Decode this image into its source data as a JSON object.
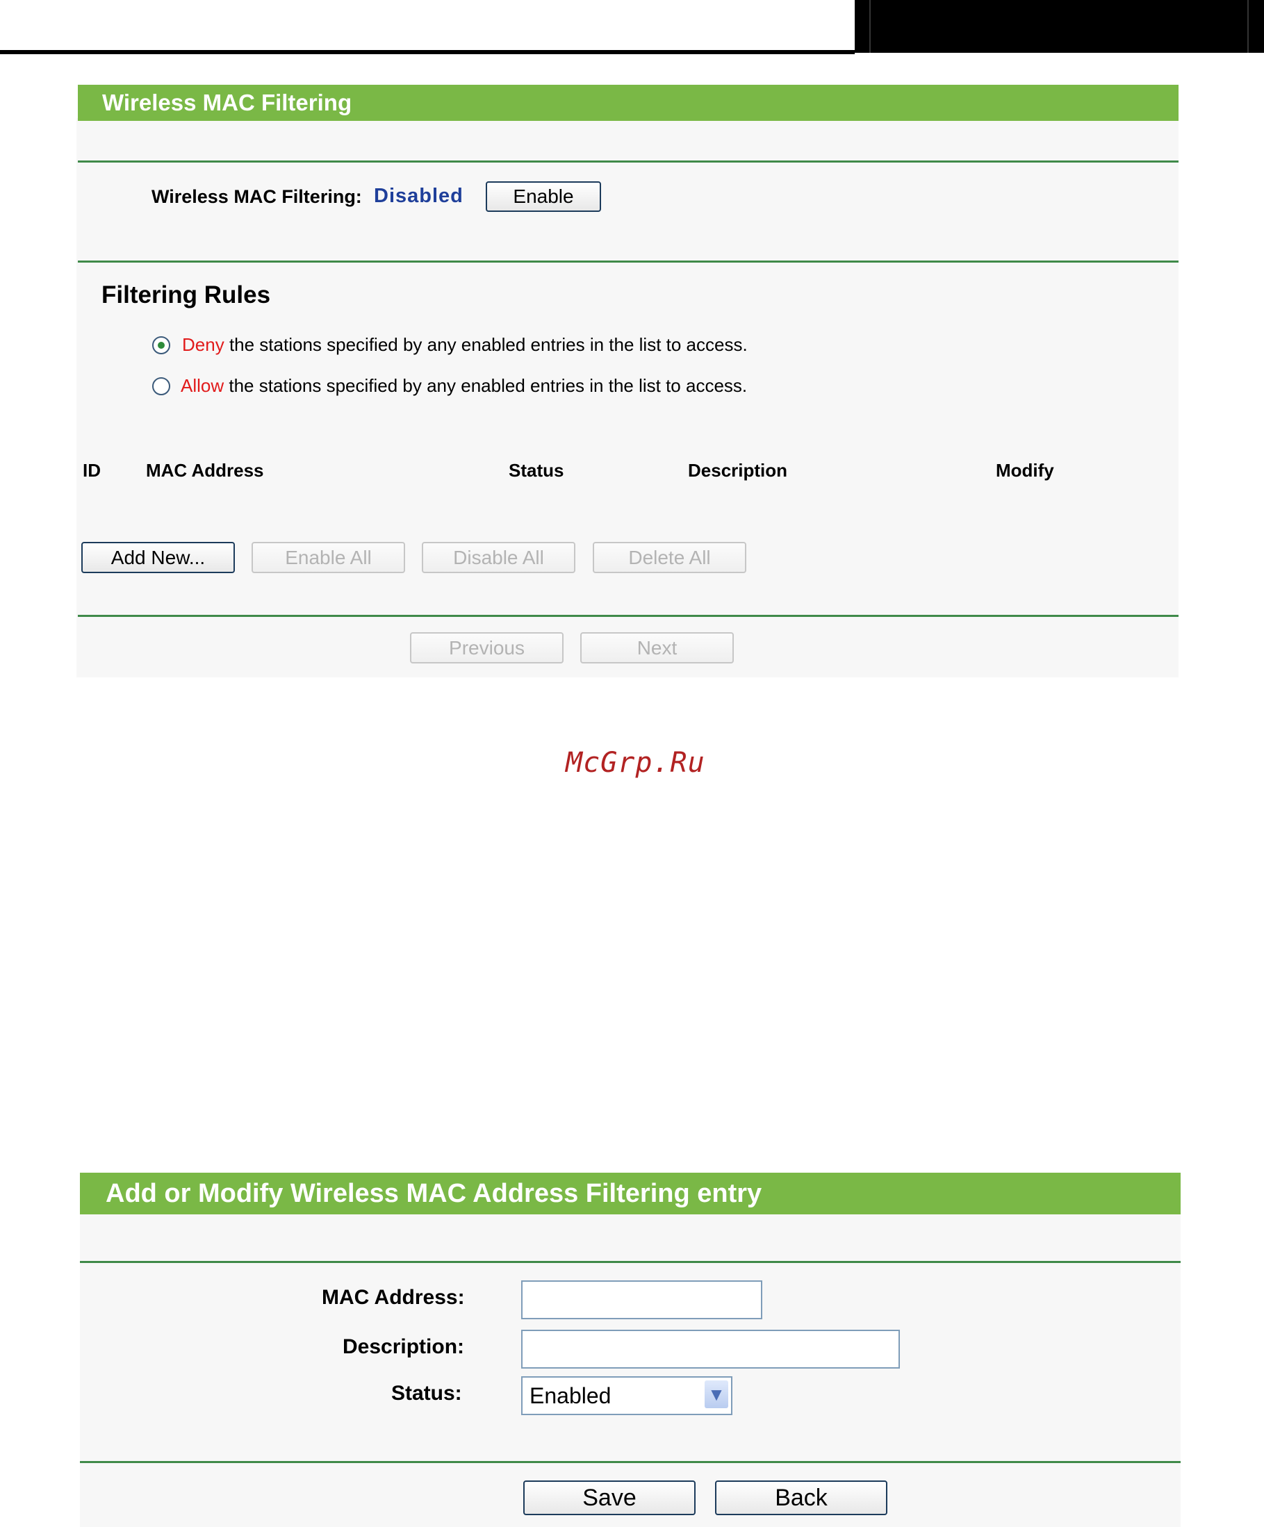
{
  "panel1": {
    "title": "Wireless MAC Filtering",
    "filtering_label": "Wireless MAC Filtering:",
    "filtering_status": "Disabled",
    "enable_button": "Enable",
    "rules_heading": "Filtering Rules",
    "deny_word": "Deny",
    "deny_text": "the stations specified by any enabled entries in the list to access.",
    "allow_word": "Allow",
    "allow_text": "the stations specified by any enabled entries in the list to access.",
    "columns": [
      "ID",
      "MAC Address",
      "Status",
      "Description",
      "Modify"
    ],
    "buttons": {
      "add_new": "Add New...",
      "enable_all": "Enable All",
      "disable_all": "Disable All",
      "delete_all": "Delete All",
      "previous": "Previous",
      "next": "Next"
    }
  },
  "watermark": "McGrp.Ru",
  "panel2": {
    "title": "Add or Modify Wireless MAC Address Filtering entry",
    "mac_label": "MAC Address:",
    "desc_label": "Description:",
    "status_label": "Status:",
    "status_value": "Enabled",
    "save_button": "Save",
    "back_button": "Back"
  },
  "colors": {
    "header_green": "#7ab846",
    "rule_green": "#3f8a49",
    "accent_red": "#e11b1b",
    "status_blue": "#1f3f9a"
  }
}
